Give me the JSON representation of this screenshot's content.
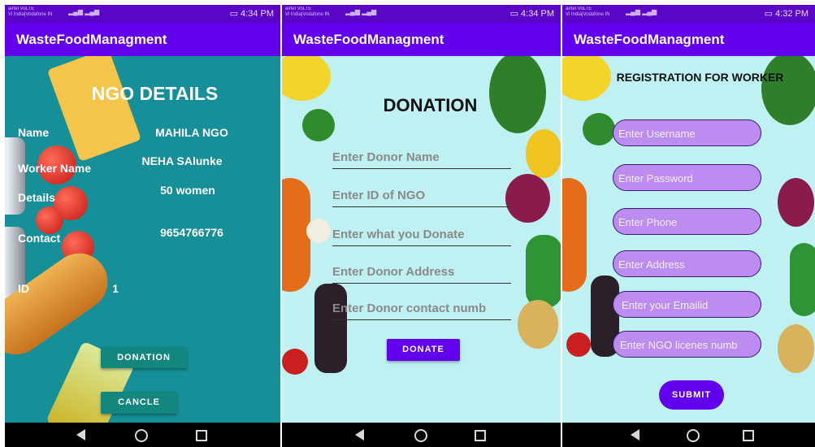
{
  "screens": [
    {
      "status": {
        "carrier": "airtel VoLTE\nVi India|Vodafone IN",
        "time": "4:34 PM"
      },
      "app_title": "WasteFoodManagment",
      "heading": "NGO DETAILS",
      "labels": [
        "Name",
        "Worker Name",
        "Details",
        "Contact",
        "ID"
      ],
      "values": [
        "MAHILA NGO",
        "NEHA SAlunke",
        "50 women",
        "9654766776",
        "1"
      ],
      "buttons": {
        "donation": "DONATION",
        "cancel": "CANCLE"
      }
    },
    {
      "status": {
        "carrier": "airtel VoLTE\nVi India|Vodafone IN",
        "time": "4:34 PM"
      },
      "app_title": "WasteFoodManagment",
      "heading": "DONATION",
      "fields": [
        "Enter Donor Name",
        "Enter ID of NGO",
        "Enter what you Donate",
        "Enter Donor Address",
        "Enter Donor contact numb"
      ],
      "button": "DONATE"
    },
    {
      "status": {
        "carrier": "airtel VoLTE\nVi India|Vodafone IN",
        "time": "4:32 PM"
      },
      "app_title": "WasteFoodManagment",
      "heading": "REGISTRATION FOR WORKER",
      "fields": [
        "Enter Username",
        "Enter Password",
        "Enter Phone",
        "Enter Address",
        "Enter your Emailid",
        "Enter NGO licenes numb"
      ],
      "button": "SUBMIT"
    }
  ],
  "icons": [
    "back-icon",
    "home-icon",
    "recents-icon",
    "battery-icon",
    "signal-icon"
  ],
  "colors": {
    "app_bar": "#6200ee",
    "status_bar": "#5b06c6",
    "teal_button": "#13877d",
    "pill_field": "#bd8cf0"
  }
}
